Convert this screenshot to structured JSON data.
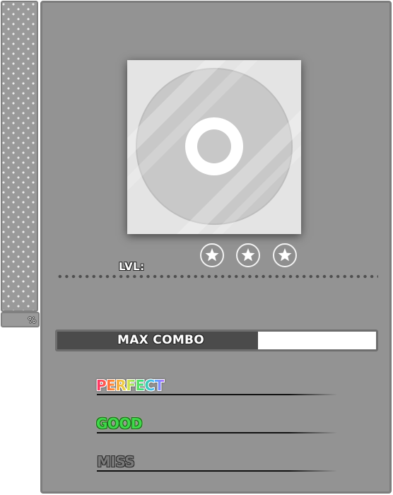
{
  "gauge": {
    "percent_label": "%"
  },
  "jacket": {
    "icon": "cd-disc-icon"
  },
  "difficulty": {
    "star_count": 3,
    "icon": "star-icon",
    "level_label": "LVL:",
    "level_value": ""
  },
  "max_combo": {
    "label": "MAX COMBO",
    "fill_fraction": 0.63
  },
  "judgements": {
    "perfect": {
      "label": "PERFECT",
      "count": ""
    },
    "good": {
      "label": "GOOD",
      "count": ""
    },
    "miss": {
      "label": "MISS",
      "count": ""
    }
  },
  "colors": {
    "panel": "#939393",
    "panel_border": "#7d7d7d",
    "combo_fill": "#4b4b4b",
    "good": "#3fd84a",
    "miss": "#7a7a7a"
  }
}
